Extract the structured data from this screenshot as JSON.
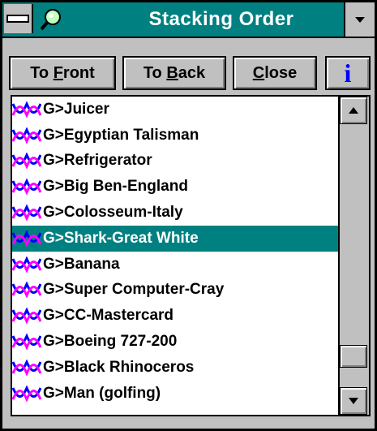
{
  "window": {
    "title": "Stacking Order",
    "accent_color": "#008080",
    "sysmenu_icon": "system-menu-icon",
    "app_icon": "magnifier-icon",
    "dropdown_icon": "chevron-down-icon"
  },
  "toolbar": {
    "to_front": {
      "prefix": "To ",
      "accel": "F",
      "rest": "ront"
    },
    "to_back": {
      "prefix": "To ",
      "accel": "B",
      "rest": "ack"
    },
    "close": {
      "prefix": "",
      "accel": "C",
      "rest": "lose"
    },
    "info_label": "i"
  },
  "list": {
    "item_icon": "group-icon",
    "items": [
      {
        "label": "G>Juicer",
        "selected": false
      },
      {
        "label": "G>Egyptian Talisman",
        "selected": false
      },
      {
        "label": "G>Refrigerator",
        "selected": false
      },
      {
        "label": "G>Big Ben-England",
        "selected": false
      },
      {
        "label": "G>Colosseum-Italy",
        "selected": false
      },
      {
        "label": "G>Shark-Great White",
        "selected": true
      },
      {
        "label": "G>Banana",
        "selected": false
      },
      {
        "label": "G>Super Computer-Cray",
        "selected": false
      },
      {
        "label": "G>CC-Mastercard",
        "selected": false
      },
      {
        "label": "G>Boeing 727-200",
        "selected": false
      },
      {
        "label": "G>Black Rhinoceros",
        "selected": false
      },
      {
        "label": "G>Man (golfing)",
        "selected": false
      }
    ],
    "scroll_position": 0.92
  }
}
